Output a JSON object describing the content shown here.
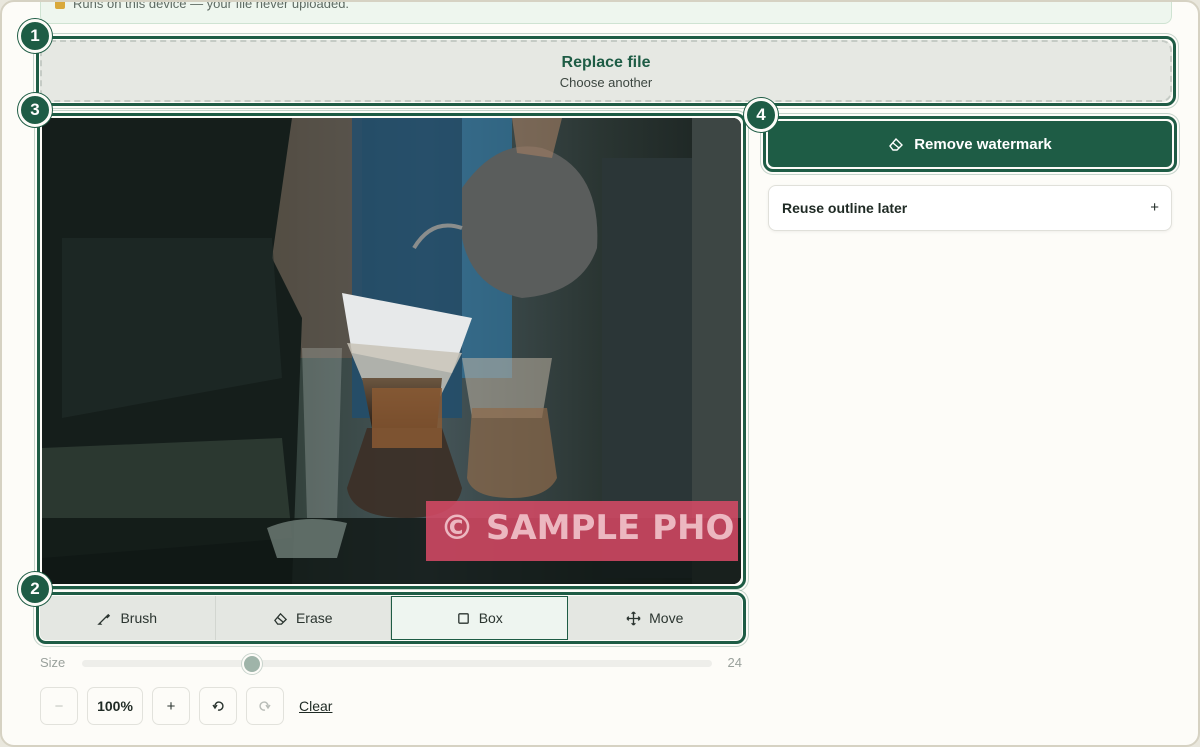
{
  "notice": {
    "text": "Runs on this device — your file never uploaded."
  },
  "badges": [
    "1",
    "2",
    "3",
    "4"
  ],
  "dropzone": {
    "title": "Replace file",
    "subtitle": "Choose another"
  },
  "canvas": {
    "image_icon": "photo-coffee-pourover",
    "watermark_text": "© SAMPLE PHO"
  },
  "tools": [
    {
      "label": "Brush",
      "icon": "brush-icon",
      "active": false
    },
    {
      "label": "Erase",
      "icon": "eraser-icon",
      "active": false
    },
    {
      "label": "Box",
      "icon": "square-icon",
      "active": true
    },
    {
      "label": "Move",
      "icon": "move-icon",
      "active": false
    }
  ],
  "size": {
    "label": "Size",
    "value": "24",
    "level_fraction": 0.27
  },
  "zoom": {
    "minus": "−",
    "percent": "100%",
    "plus": "+",
    "clear": "Clear"
  },
  "actions": {
    "remove_label": "Remove watermark",
    "reuse_label": "Reuse outline later",
    "reuse_toggle": "+"
  },
  "colors": {
    "accent": "#1e5c45",
    "watermark": "#d94a66",
    "background": "#fdfcf8"
  }
}
